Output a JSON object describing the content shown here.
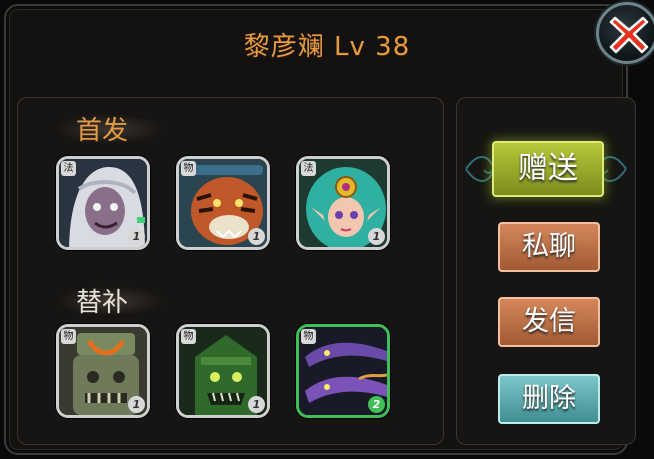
{
  "header": {
    "title": "黎彦斓  Lv 38"
  },
  "sections": {
    "starter_label": "首发",
    "substitute_label": "替补"
  },
  "starters": [
    {
      "name": "pale-haired-ghoul-hero",
      "tag": "法",
      "count": "1"
    },
    {
      "name": "tiger-warrior-hero",
      "tag": "物",
      "count": "1"
    },
    {
      "name": "teal-haired-elf-hero",
      "tag": "法",
      "count": "1"
    }
  ],
  "substitutes": [
    {
      "name": "stone-totem-golem",
      "tag": "物",
      "count": "1"
    },
    {
      "name": "green-armored-ogre",
      "tag": "物",
      "count": "1"
    },
    {
      "name": "purple-twin-serpent",
      "tag": "物",
      "count": "2"
    }
  ],
  "actions": {
    "gift": "赠送",
    "private_chat": "私聊",
    "send_mail": "发信",
    "delete": "删除"
  },
  "icons": {
    "close": "close-x-icon"
  },
  "colors": {
    "title": "#e39a43",
    "gift_button": "#9aae2a",
    "action_button": "#c07550",
    "delete_button": "#5fb3b6",
    "highlight_border": "#3fbf55"
  }
}
